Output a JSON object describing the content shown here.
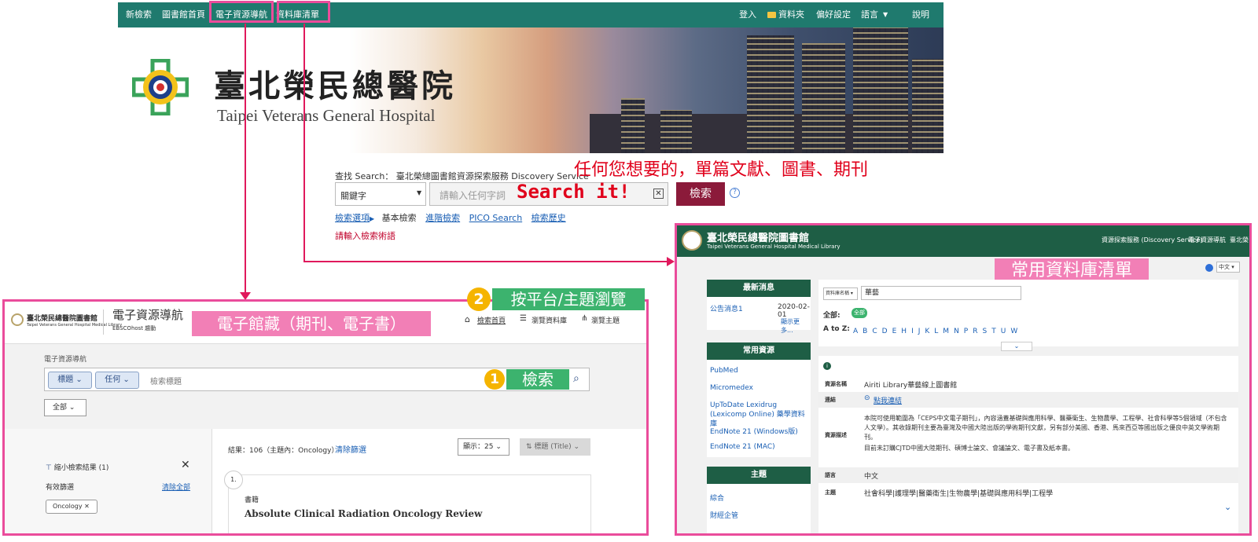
{
  "top_nav": {
    "left_items": [
      "新檢索",
      "圖書館首頁",
      "電子資源導航",
      "資料庫清單"
    ],
    "right_items": [
      "登入",
      "資料夾",
      "偏好設定",
      "語言",
      "說明"
    ]
  },
  "banner": {
    "hospital_name_zh": "臺北榮民總醫院",
    "hospital_name_en": "Taipei Veterans General Hospital"
  },
  "search": {
    "caption": "查找 Search： 臺北榮總圖書館資源探索服務 Discovery Service",
    "field_select": "關鍵字",
    "placeholder": "請輸入任何字詞",
    "button": "檢索",
    "help": "?",
    "links": [
      "檢索選項",
      "基本檢索",
      "進階檢索",
      "PICO Search",
      "檢索歷史"
    ],
    "hint": "請輸入檢索術語"
  },
  "annotations": {
    "search_it": "Search it!",
    "anything": "任何您想要的，單篇文獻、圖書、期刊",
    "db_list": "常用資料庫清單",
    "e_collection": "電子館藏（期刊、電子書）",
    "browse_num": "2",
    "browse": "按平台/主題瀏覽",
    "search_num": "1",
    "search": "檢索"
  },
  "library": {
    "title": "臺北榮民總醫院圖書館",
    "subtitle": "Taipei Veterans General Hospital Medical Library",
    "header_links": [
      "資源探索服務 (Discovery Service)",
      "電子資源導航",
      "臺北榮"
    ],
    "lang": "中文",
    "news": {
      "title": "最新消息",
      "items": [
        {
          "label": "公告消息1",
          "date": "2020-02-01"
        }
      ],
      "more": "顯示更多..."
    },
    "common": {
      "title": "常用資源",
      "items": [
        "PubMed",
        "Micromedex",
        "UpToDate Lexidrug (Lexicomp Online) 藥學資料庫",
        "EndNote 21 (Windows版)",
        "EndNote 21 (MAC)"
      ]
    },
    "subject": {
      "title": "主題",
      "items": [
        "綜合",
        "財經企管"
      ]
    },
    "filter": {
      "select": "資料庫名稱",
      "value": "華藝",
      "all_label": "全部:",
      "all_badge": "全部",
      "az_label": "A to Z:",
      "letters": [
        "A",
        "B",
        "C",
        "D",
        "E",
        "H",
        "I",
        "J",
        "K",
        "L",
        "M",
        "N",
        "P",
        "R",
        "S",
        "T",
        "U",
        "W"
      ]
    },
    "detail": {
      "name_label": "資源名稱",
      "name": "Airiti Library華藝線上圖書館",
      "link_label": "連結",
      "link": "點我連結",
      "desc_label": "資源描述",
      "desc1": "本院可使用範圍為「CEPS中文電子期刊」，內容涵蓋基礎與應用科學、醫藥衛生、生物農學、工程學、社會科學等5個領域（不包含人文學）。其收錄期刊主要為臺灣及中國大陸出版的學術期刊文獻，另有部分美國、香港、馬來西亞等國出版之優良中英文學術期刊。",
      "desc2": "目前未訂購CJTD中國大陸期刊、碩博士論文、會議論文、電子書及紙本書。",
      "lang_label": "語言",
      "lang": "中文",
      "subj_label": "主題",
      "subj": "社會科學|護理學|醫藥衛生|生物農學|基礎與應用科學|工程學"
    }
  },
  "ebsco": {
    "logo": "臺北榮民總醫院圖書館",
    "logo_sub": "Taipei Veterans General Hospital Medical Library",
    "title": "電子資源導航",
    "subtitle": "EBSCOhost 趨動",
    "nav": [
      "檢索首頁",
      "瀏覽資料庫",
      "瀏覽主題"
    ],
    "breadcrumb": "電子資源導航",
    "chip_title": "標題",
    "chip_any": "任何",
    "search_placeholder": "檢索標題",
    "scope": "全部",
    "refine": "縮小檢索結果 (1)",
    "active_filters": "有效篩選",
    "clear_all": "清除全部",
    "filter_chip": "Oncology",
    "results": "結果：106（主題內：Oncology）",
    "clear_filter": "清除篩選",
    "show": "顯示：25",
    "sort": "標題 (Title)",
    "result_num": "1.",
    "result_type": "書籍",
    "result_title": "Absolute Clinical Radiation Oncology Review"
  },
  "colors": {
    "nav_teal": "#1f7a6e",
    "library_green": "#1e5e45",
    "search_button": "#8b1a3a",
    "highlight_pink": "#ea4c9b",
    "annotation_red": "#e0001b"
  }
}
